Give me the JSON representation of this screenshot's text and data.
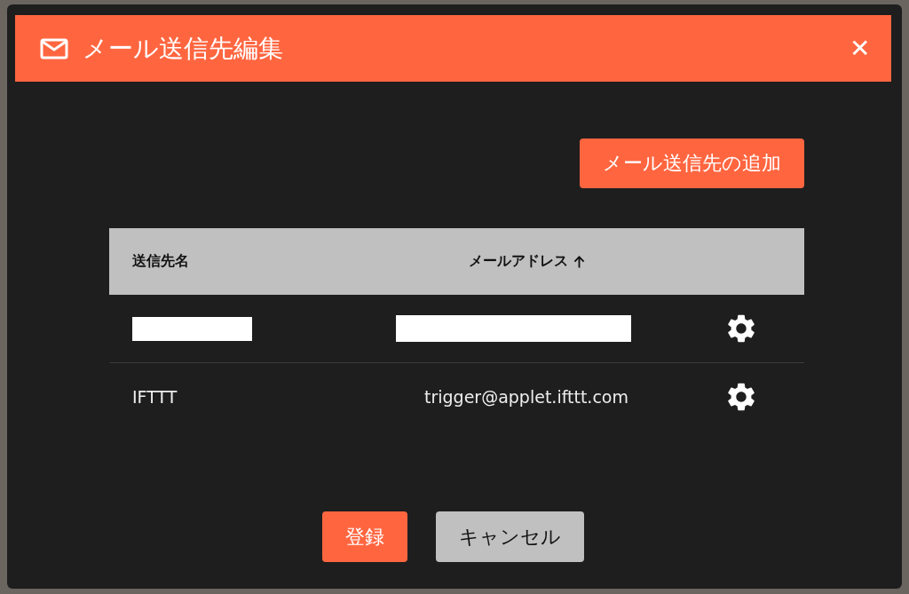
{
  "dialog": {
    "title": "メール送信先編集",
    "close": "✕"
  },
  "add_button": "メール送信先の追加",
  "table": {
    "columns": [
      {
        "label": "送信先名",
        "sorted": false
      },
      {
        "label": "メールアドレス",
        "sorted": true
      }
    ],
    "rows": [
      {
        "kind": "redacted"
      },
      {
        "kind": "text",
        "name": "IFTTT",
        "address": "trigger@applet.ifttt.com"
      }
    ]
  },
  "buttons": [
    {
      "label": "登録",
      "kind": "primary"
    },
    {
      "label": "キャンセル",
      "kind": "secondary"
    }
  ]
}
